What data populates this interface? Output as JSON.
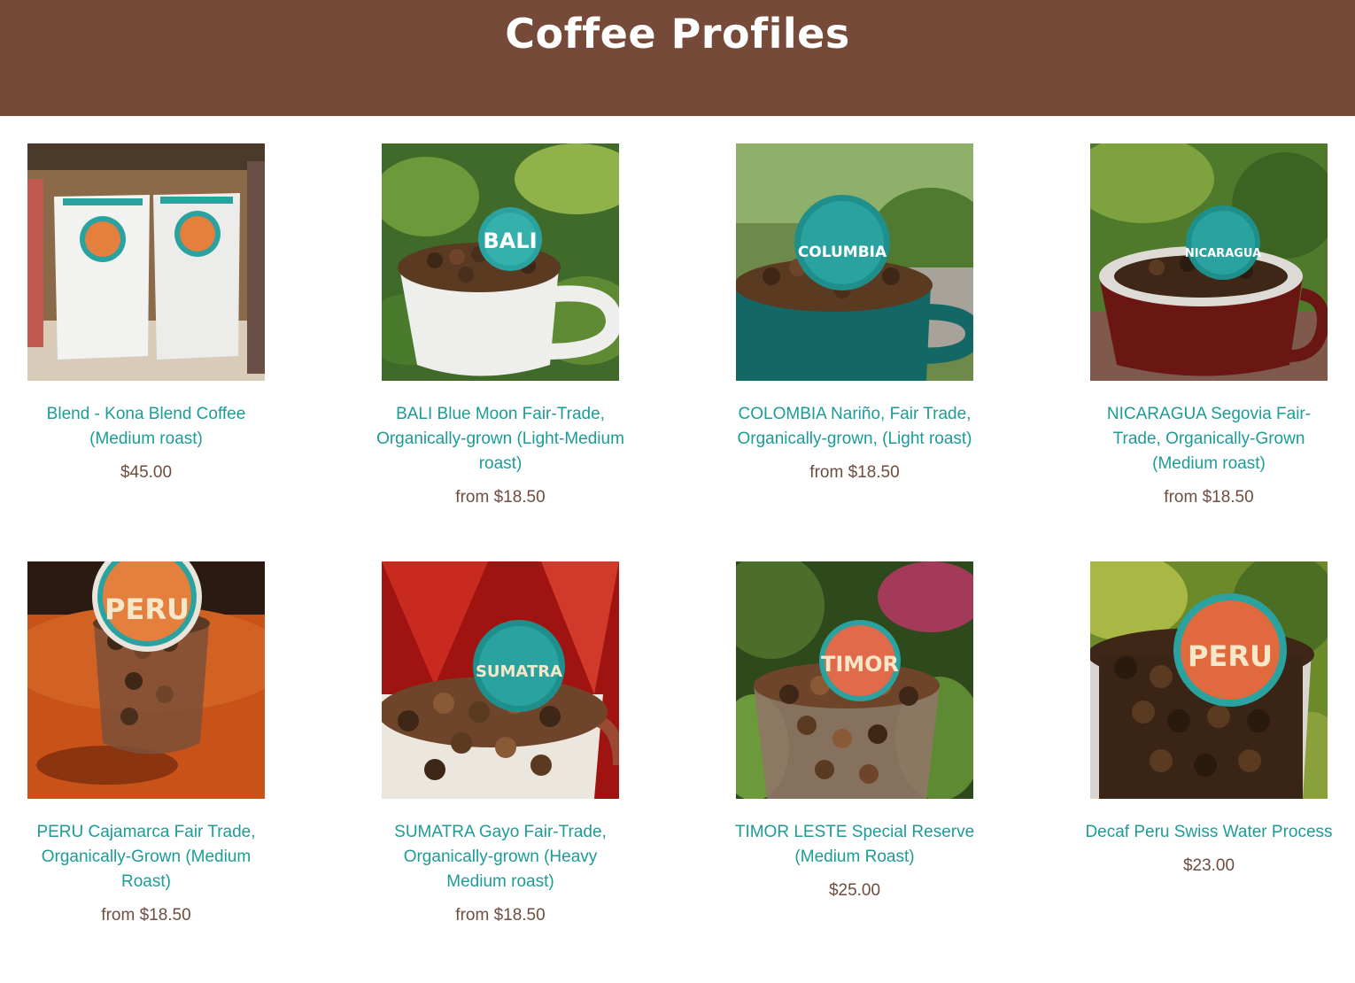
{
  "header": {
    "title": "Coffee Profiles",
    "bg_color": "#764a39"
  },
  "colors": {
    "link": "#1b9c97",
    "price": "#6e4d3f"
  },
  "products": [
    {
      "name": "Blend - Kona Blend Coffee (Medium roast)",
      "price": "$45.00",
      "image_icon": "coffee-bags-image"
    },
    {
      "name": "BALI Blue Moon Fair-Trade, Organically-grown (Light-Medium roast)",
      "price": "from $18.50",
      "image_icon": "bali-coffee-cup-image",
      "tag": "BALI"
    },
    {
      "name": "COLOMBIA Nariño, Fair Trade, Organically-grown, (Light roast)",
      "price": "from $18.50",
      "image_icon": "colombia-coffee-cup-image",
      "tag": "COLUMBIA"
    },
    {
      "name": "NICARAGUA Segovia Fair-Trade, Organically-Grown (Medium roast)",
      "price": "from $18.50",
      "image_icon": "nicaragua-coffee-cup-image",
      "tag": "NICARAGUA"
    },
    {
      "name": "PERU Cajamarca Fair Trade, Organically-Grown (Medium Roast)",
      "price": "from $18.50",
      "image_icon": "peru-coffee-glass-image",
      "tag": "PERU"
    },
    {
      "name": "SUMATRA Gayo Fair-Trade, Organically-grown (Heavy Medium roast)",
      "price": "from $18.50",
      "image_icon": "sumatra-coffee-cup-image",
      "tag": "SUMATRA"
    },
    {
      "name": "TIMOR LESTE Special Reserve (Medium Roast)",
      "price": "$25.00",
      "image_icon": "timor-coffee-glass-image",
      "tag": "TIMOR"
    },
    {
      "name": "Decaf Peru Swiss Water Process",
      "price": "$23.00",
      "image_icon": "decaf-peru-coffee-cup-image",
      "tag": "PERU"
    }
  ]
}
